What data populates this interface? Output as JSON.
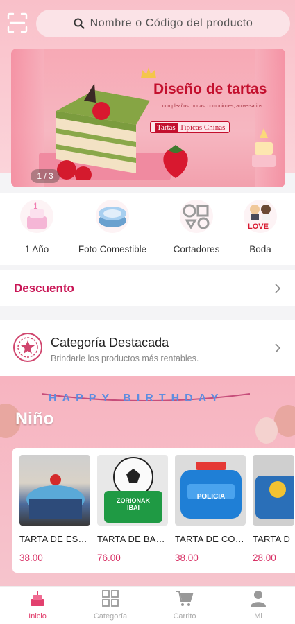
{
  "search": {
    "placeholder": "Nombre o Código del producto"
  },
  "banner": {
    "title": "Diseño de tartas",
    "subtitle": "cumpleaños, bodas, comuniones, aniversarios...",
    "tag_highlight": "Tartas",
    "tag_rest": "Típicas Chinas",
    "counter": "1 / 3"
  },
  "categories": [
    {
      "label": "1 Año",
      "icon": "birthday-cake-one-icon"
    },
    {
      "label": "Foto Comestible",
      "icon": "photo-cake-icon"
    },
    {
      "label": "Cortadores",
      "icon": "cookie-cutters-icon"
    },
    {
      "label": "Boda",
      "icon": "wedding-love-icon"
    }
  ],
  "discount": {
    "title": "Descuento"
  },
  "featured": {
    "title": "Categoría Destacada",
    "subtitle": "Brindarle los productos más rentables."
  },
  "kids": {
    "title": "Niño",
    "banner_letters": "HAPPY BIRTHDAY",
    "products": [
      {
        "name": "TARTA DE ES…",
        "price": "38.00",
        "decoration_text": ""
      },
      {
        "name": "TARTA DE BA…",
        "price": "76.00",
        "decoration_text": "ZORIONAK IBAI"
      },
      {
        "name": "TARTA DE CO…",
        "price": "38.00",
        "decoration_text": "POLICIA"
      },
      {
        "name": "TARTA D",
        "price": "28.00",
        "decoration_text": ""
      }
    ]
  },
  "tabs": [
    {
      "label": "Inicio",
      "active": true
    },
    {
      "label": "Categoría",
      "active": false
    },
    {
      "label": "Carrito",
      "active": false
    },
    {
      "label": "Mi",
      "active": false
    }
  ],
  "colors": {
    "accent": "#e2406e",
    "discount": "#c91656",
    "price": "#d83266",
    "banner_title": "#c3102e"
  }
}
